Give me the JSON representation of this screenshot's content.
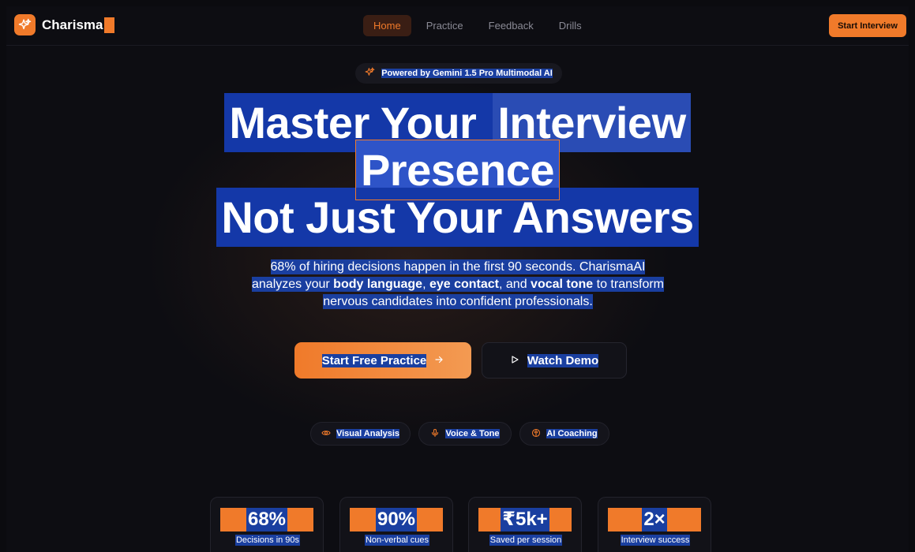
{
  "brand": {
    "name": "Charisma"
  },
  "nav": {
    "links": [
      "Home",
      "Practice",
      "Feedback",
      "Drills"
    ],
    "active": "Home",
    "cta_label": "Start Interview"
  },
  "badge": {
    "text": "Powered by Gemini 1.5 Pro Multimodal AI",
    "icon": "sparkle-icon"
  },
  "hero": {
    "line1_a": "Master Your ",
    "line1_b": "Interview",
    "line2": "Presence",
    "line3": "Not Just Your Answers"
  },
  "subtext": {
    "p1": "68% of hiring decisions happen in the first 90 seconds. CharismaAI",
    "p2a": "analyzes your ",
    "p2b": "body language",
    "p2c": ", ",
    "p2d": "eye contact",
    "p2e": ", and ",
    "p2f": "vocal tone",
    "p2g": " to transform",
    "p3": "nervous candidates into confident professionals."
  },
  "buttons": {
    "primary_label": "Start Free Practice",
    "secondary_label": "Watch Demo"
  },
  "features": [
    {
      "label": "Visual Analysis",
      "icon": "eye-icon"
    },
    {
      "label": "Voice & Tone",
      "icon": "microphone-icon"
    },
    {
      "label": "AI Coaching",
      "icon": "brain-icon"
    }
  ],
  "stats": [
    {
      "value": "68%",
      "label": "Decisions in 90s"
    },
    {
      "value": "90%",
      "label": "Non-verbal cues"
    },
    {
      "value": "₹5k+",
      "label": "Saved per session"
    },
    {
      "value": "2×",
      "label": "Interview success"
    }
  ],
  "colors": {
    "accent": "#f07a2a",
    "selection": "#1a3fa0",
    "background": "#0d0d12"
  }
}
